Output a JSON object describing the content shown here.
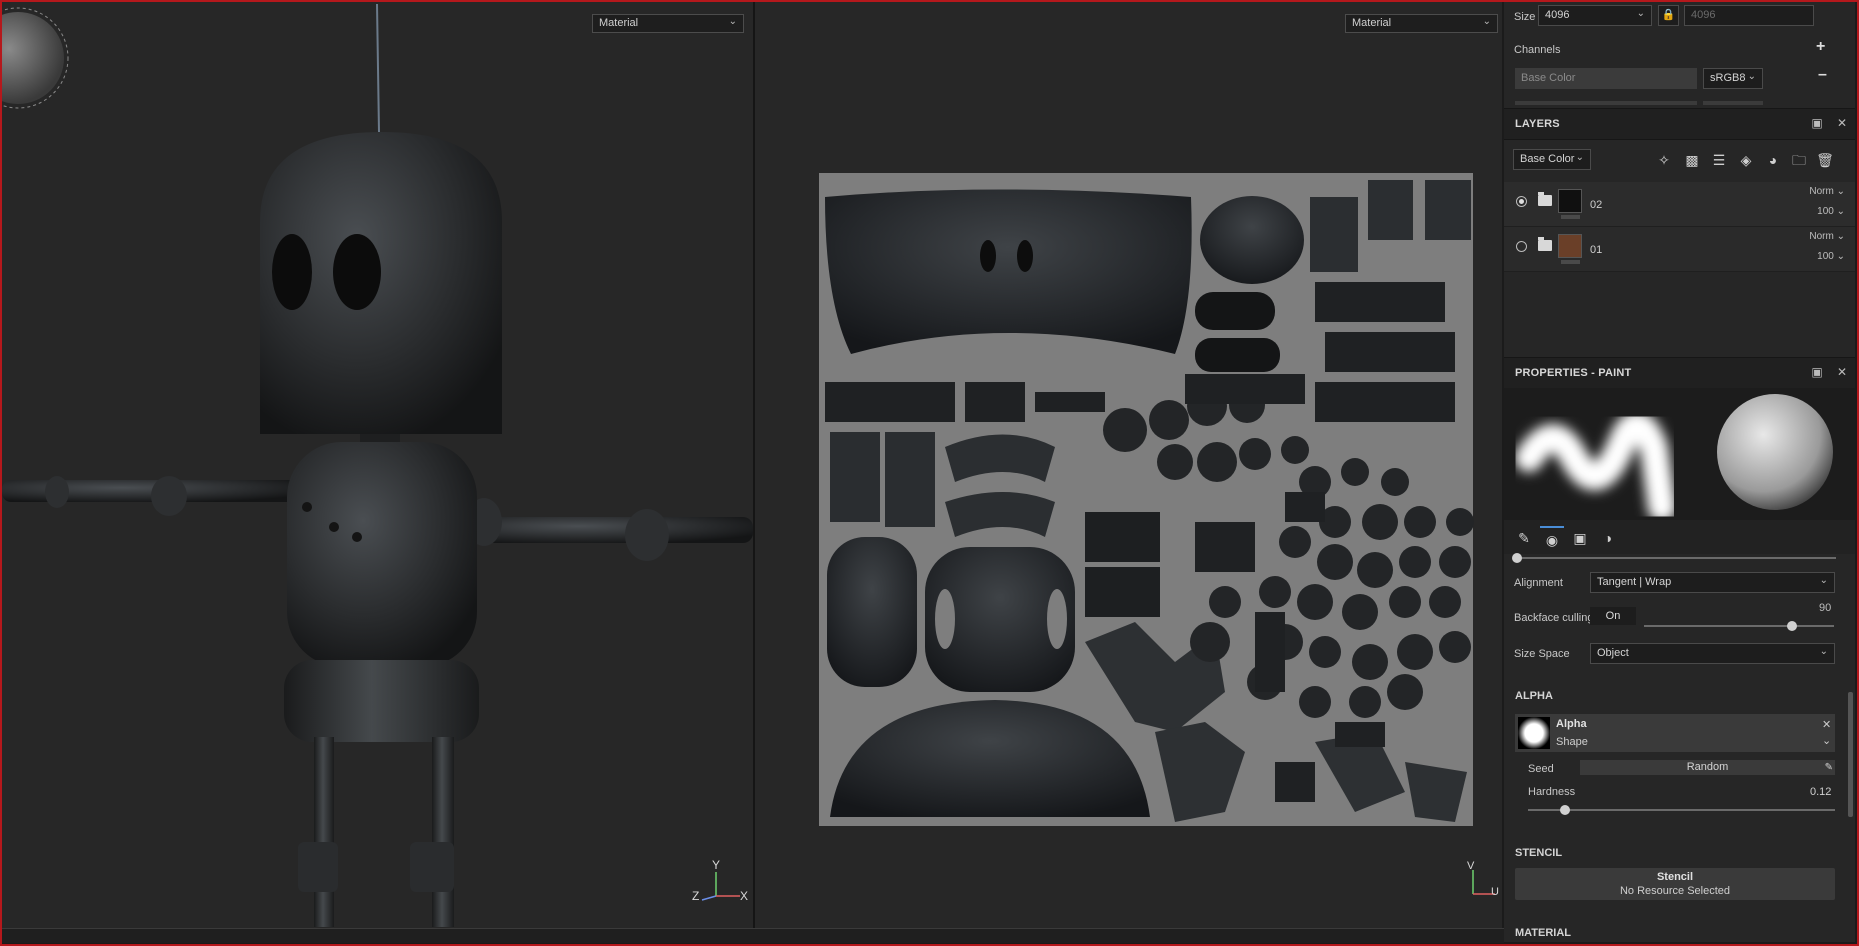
{
  "viewport_3d": {
    "mode_label": "Material",
    "axis_x": "X",
    "axis_y": "Y",
    "axis_z": "Z"
  },
  "viewport_2d": {
    "mode_label": "Material",
    "axis_v": "V",
    "axis_u": "U"
  },
  "texture_set": {
    "size_label": "Size",
    "size_value": "4096",
    "size_linked_value": "4096",
    "channels_label": "Channels",
    "channel_name": "Base Color",
    "channel_format": "sRGB8"
  },
  "layers": {
    "title": "LAYERS",
    "channel_select": "Base Color",
    "toolbar_icons": [
      "add-effect-icon",
      "add-mask-icon",
      "add-layer-icon",
      "add-fill-layer-icon",
      "add-anchor-icon",
      "add-folder-icon",
      "delete-icon"
    ],
    "items": [
      {
        "name": "02",
        "blend": "Norm",
        "opacity": "100",
        "color": "#101010",
        "selected": true
      },
      {
        "name": "01",
        "blend": "Norm",
        "opacity": "100",
        "color": "#6a3f28",
        "selected": false
      }
    ]
  },
  "properties": {
    "title": "PROPERTIES - PAINT",
    "alignment_label": "Alignment",
    "alignment_value": "Tangent | Wrap",
    "backface_label": "Backface culling",
    "backface_value": "On",
    "backface_angle": "90",
    "backface_angle_fraction": 0.78,
    "size_space_label": "Size Space",
    "size_space_value": "Object",
    "alpha_section": "ALPHA",
    "alpha_name": "Alpha",
    "alpha_type": "Shape",
    "seed_label": "Seed",
    "seed_value": "Random",
    "hardness_label": "Hardness",
    "hardness_value": "0.12",
    "hardness_fraction": 0.12,
    "stencil_section": "STENCIL",
    "stencil_title": "Stencil",
    "stencil_sub": "No Resource Selected",
    "material_section": "MATERIAL"
  }
}
